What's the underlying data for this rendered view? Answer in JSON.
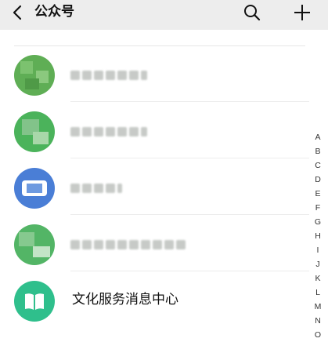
{
  "header": {
    "title": "公众号"
  },
  "accounts": [
    {
      "name_visible": false,
      "avatar_color": "#5fae55"
    },
    {
      "name_visible": false,
      "avatar_color": "#4bb35b"
    },
    {
      "name_visible": false,
      "avatar_color": "#4a7ed6"
    },
    {
      "name_visible": false,
      "avatar_color": "#53b566"
    },
    {
      "name": "文化服务消息中心",
      "avatar_color": "#2fbf8c",
      "icon": "book-icon"
    }
  ],
  "alpha_index": [
    "A",
    "B",
    "C",
    "D",
    "E",
    "F",
    "G",
    "H",
    "I",
    "J",
    "K",
    "L",
    "M",
    "N",
    "O"
  ]
}
